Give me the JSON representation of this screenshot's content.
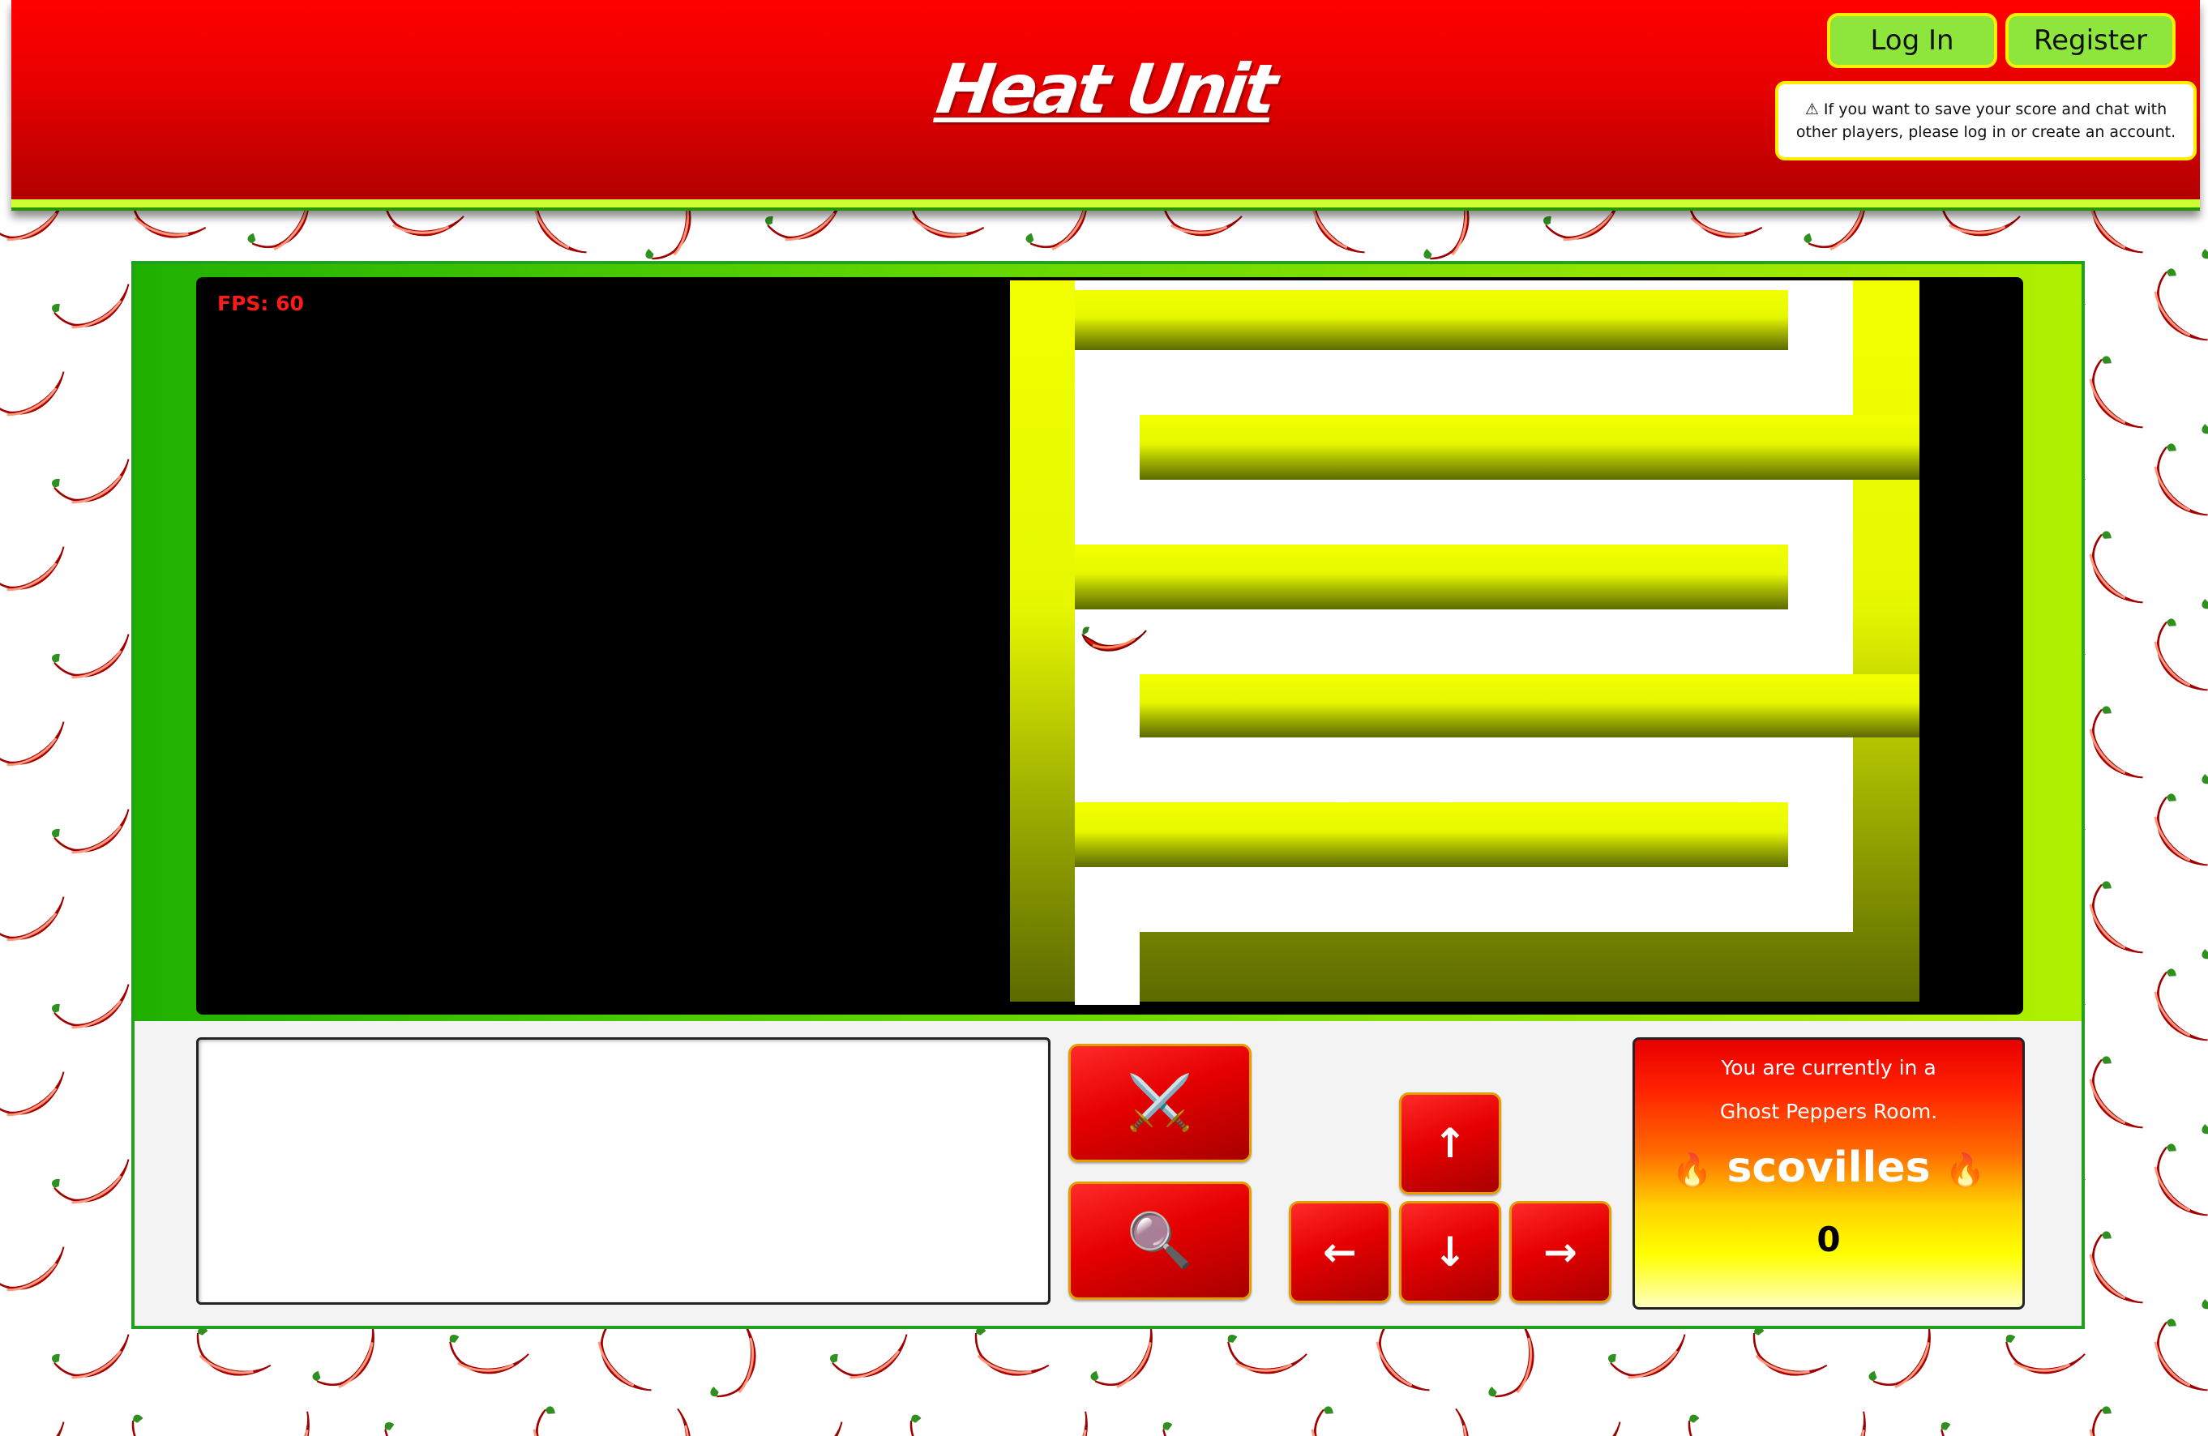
{
  "app": {
    "title": "Heat Unit"
  },
  "header": {
    "login_label": "Log In",
    "register_label": "Register",
    "notice": "⚠ If you want to save your score and chat with other players, please log in or create an account."
  },
  "game": {
    "fps_label": "FPS: 60",
    "player_icon": "chili-pepper",
    "maze_colors": {
      "wall": "#f0ff00",
      "wall_dark": "#5a6a00",
      "corridor": "#ffffff",
      "void": "#000000"
    }
  },
  "controls": {
    "attack_icon": "⚔️",
    "search_icon": "🔍",
    "arrows": {
      "up": "↑",
      "left": "←",
      "down": "↓",
      "right": "→"
    }
  },
  "status": {
    "line1": "You are currently in a",
    "line2": "Ghost Peppers Room.",
    "flame": "🔥",
    "units": "scovilles",
    "score": "0"
  },
  "colors": {
    "accent_red": "#e60000",
    "accent_green": "#8ee63c",
    "accent_yellow": "#ffee00"
  }
}
